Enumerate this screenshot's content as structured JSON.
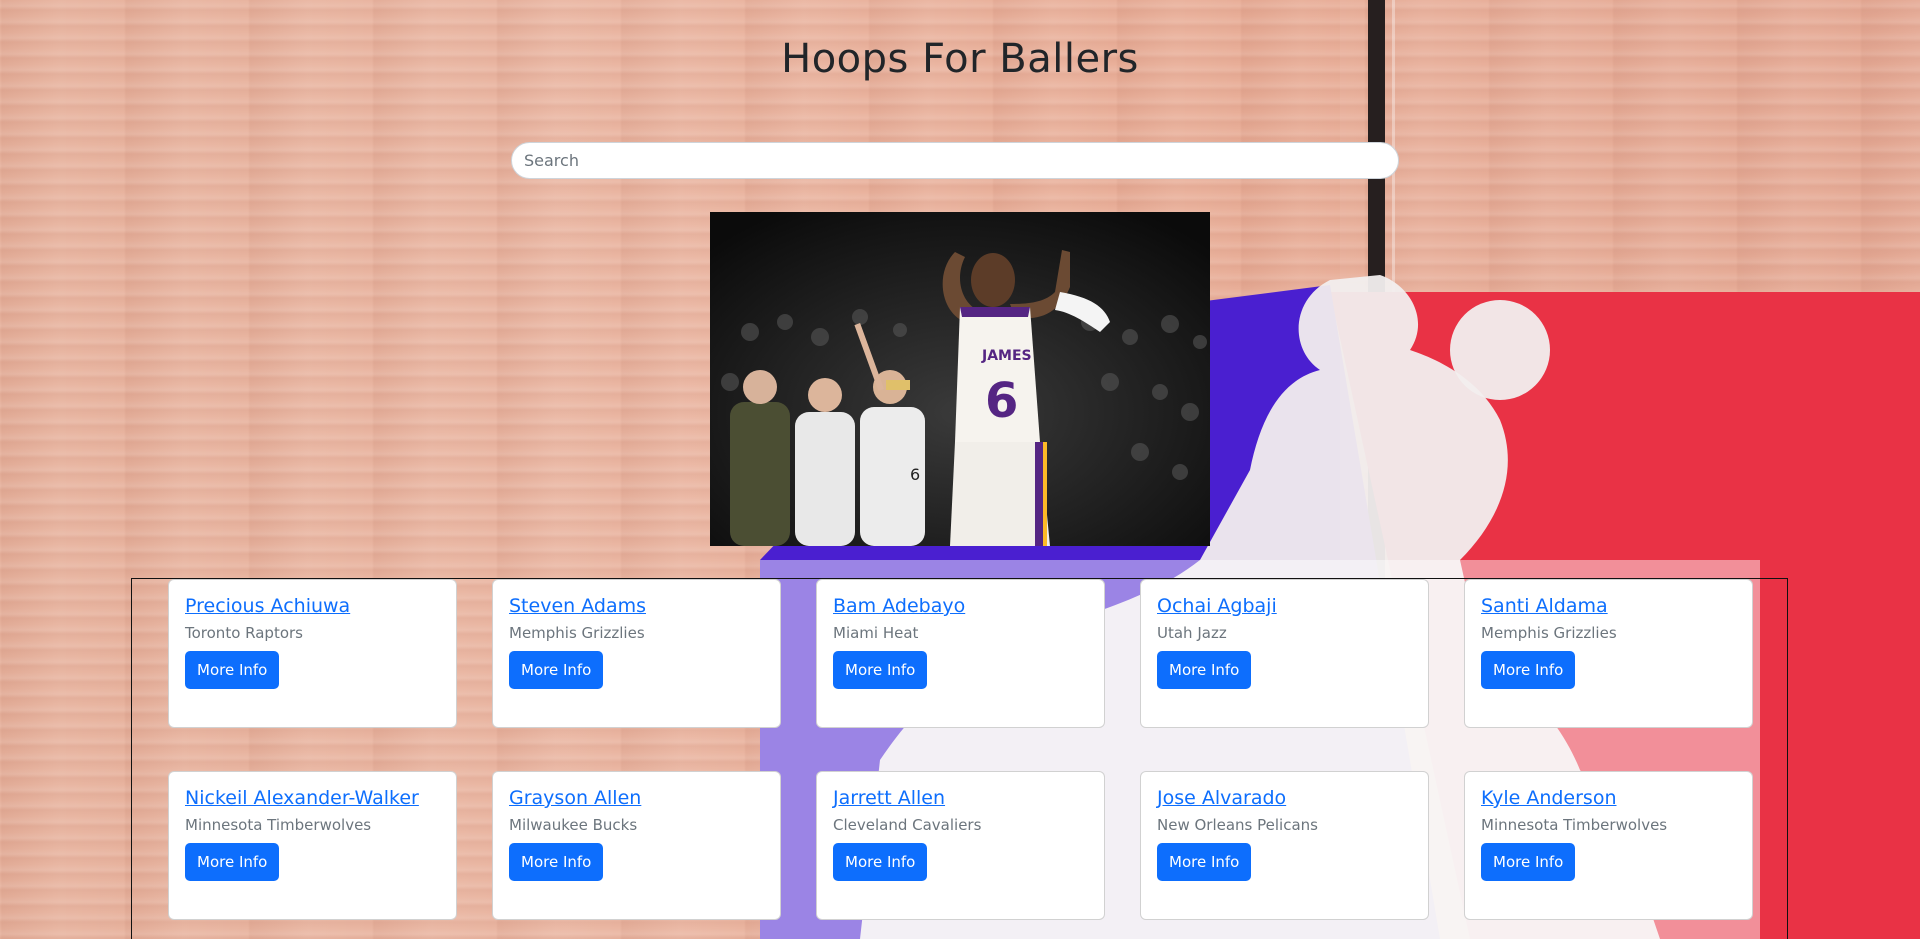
{
  "page": {
    "title": "Hoops For Ballers"
  },
  "search": {
    "placeholder": "Search",
    "value": ""
  },
  "hero": {
    "jersey_name": "JAMES",
    "jersey_number": "6",
    "accent_colors": {
      "jersey": "#f6f3ee",
      "purple": "#552583",
      "gold": "#fdb927"
    }
  },
  "players": [
    {
      "name": "Precious Achiuwa",
      "team": "Toronto Raptors",
      "button": "More Info"
    },
    {
      "name": "Steven Adams",
      "team": "Memphis Grizzlies",
      "button": "More Info"
    },
    {
      "name": "Bam Adebayo",
      "team": "Miami Heat",
      "button": "More Info"
    },
    {
      "name": "Ochai Agbaji",
      "team": "Utah Jazz",
      "button": "More Info"
    },
    {
      "name": "Santi Aldama",
      "team": "Memphis Grizzlies",
      "button": "More Info"
    },
    {
      "name": "Nickeil Alexander-Walker",
      "team": "Minnesota Timberwolves",
      "button": "More Info"
    },
    {
      "name": "Grayson Allen",
      "team": "Milwaukee Bucks",
      "button": "More Info"
    },
    {
      "name": "Jarrett Allen",
      "team": "Cleveland Cavaliers",
      "button": "More Info"
    },
    {
      "name": "Jose Alvarado",
      "team": "New Orleans Pelicans",
      "button": "More Info"
    },
    {
      "name": "Kyle Anderson",
      "team": "Minnesota Timberwolves",
      "button": "More Info"
    }
  ],
  "colors": {
    "link": "#0d6efd",
    "button_bg": "#0d6efd",
    "muted_text": "#6c757d",
    "logo_blue": "#4a1fd0",
    "logo_red": "#e8283c"
  }
}
